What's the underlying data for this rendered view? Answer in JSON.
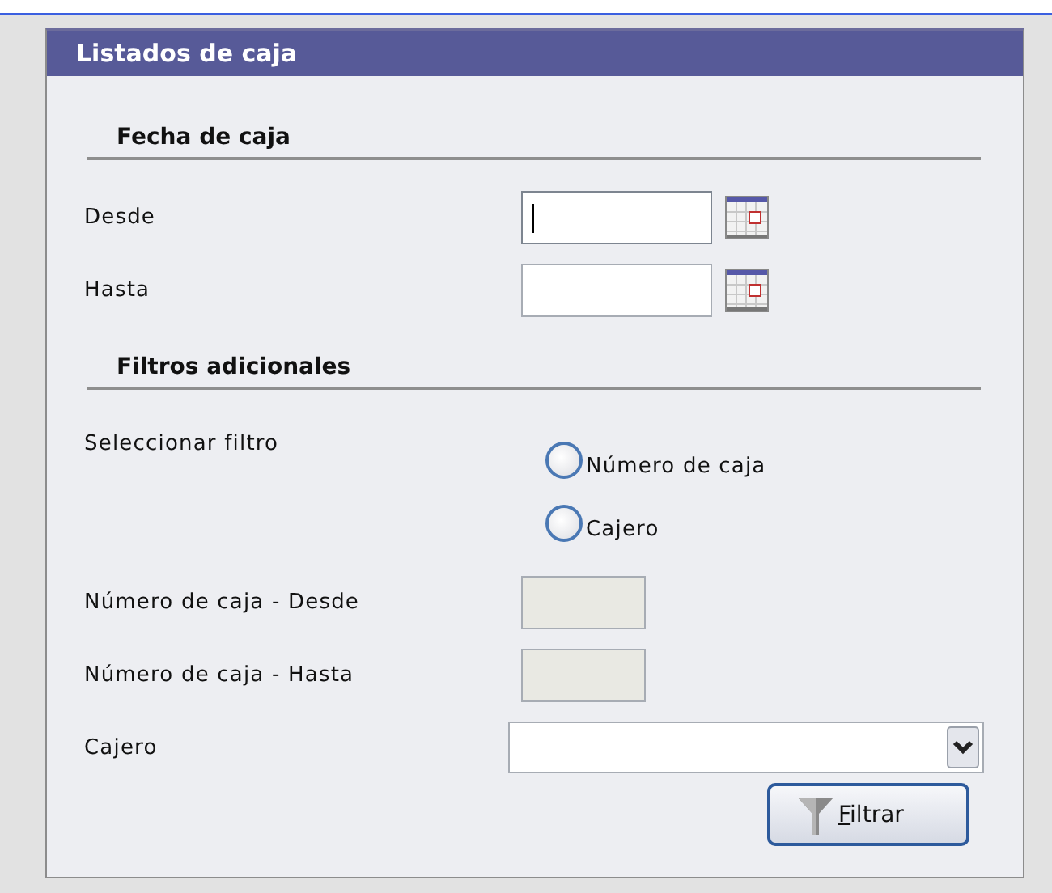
{
  "panel": {
    "title": "Listados de caja"
  },
  "sections": [
    {
      "heading": "Fecha de caja",
      "rows": [
        {
          "kind": "date",
          "label": "Desde",
          "focused": true
        },
        {
          "kind": "date",
          "label": "Hasta",
          "focused": false
        }
      ]
    },
    {
      "heading": "Filtros adicionales",
      "rows": [
        {
          "kind": "radios",
          "label": "Seleccionar filtro",
          "options": [
            {
              "label": "Número de caja",
              "selected": false
            },
            {
              "label": "Cajero",
              "selected": false
            }
          ]
        },
        {
          "kind": "text",
          "label": "Número de caja - Desde",
          "disabled": true
        },
        {
          "kind": "text",
          "label": "Número de caja - Hasta",
          "disabled": true
        },
        {
          "kind": "select",
          "label": "Cajero"
        }
      ]
    }
  ],
  "button": {
    "label": "Filtrar"
  }
}
